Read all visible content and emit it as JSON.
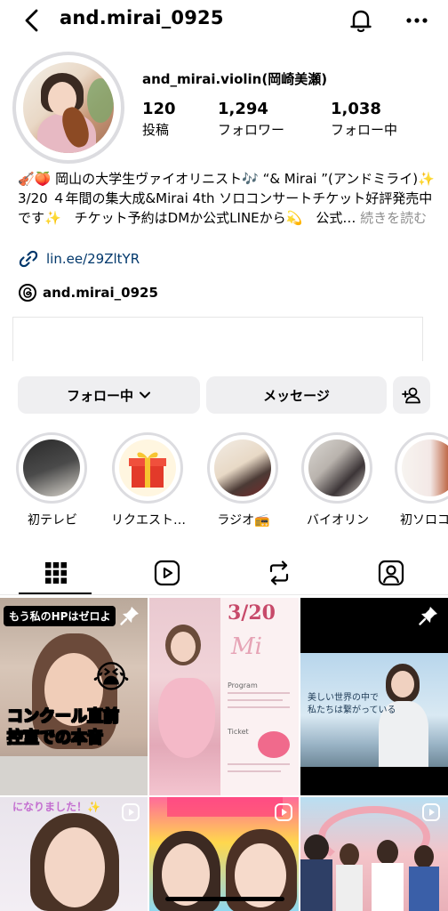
{
  "header": {
    "username": "and.mirai_0925"
  },
  "profile": {
    "display_name": "and_mirai.violin(岡崎美瀬)",
    "stats": [
      {
        "value": "120",
        "label": "投稿"
      },
      {
        "value": "1,294",
        "label": "フォロワー"
      },
      {
        "value": "1,038",
        "label": "フォロー中"
      }
    ],
    "bio_line1": "🎻🍑 岡山の大学生ヴァイオリニスト🎶 “& Mirai ”(アンドミライ)✨",
    "bio_line2": "3/20 ４年間の集大成&Mirai 4th ソロコンサートチケット好評発売中です✨　チケット予約はDMか公式LINEから💫　公式…",
    "bio_more": "続きを読む",
    "link": "lin.ee/29ZltYR",
    "threads_handle": "and.mirai_0925"
  },
  "actions": {
    "follow_label": "フォロー中",
    "message_label": "メッセージ"
  },
  "highlights": [
    {
      "label": "初テレビ"
    },
    {
      "label": "リクエスト…"
    },
    {
      "label": "ラジオ📻"
    },
    {
      "label": "バイオリン"
    },
    {
      "label": "初ソロコン"
    }
  ],
  "posts": {
    "post1_top": "もう私のHPはゼロよ",
    "post1_main": "コンクール直前",
    "post1_main2": "控室での",
    "post1_red": "本音",
    "post2_date": "3/20",
    "post2_sub": "Ticket",
    "post2_prog": "Program",
    "post3_caption1": "美しい世界の中で",
    "post3_caption2": "私たちは繋がっている",
    "post4_top": "になりました！✨"
  },
  "colors": {
    "link": "#00376b",
    "button_bg": "#efeff1",
    "muted": "#8e8e8e",
    "caption_red": "#e0291d"
  }
}
